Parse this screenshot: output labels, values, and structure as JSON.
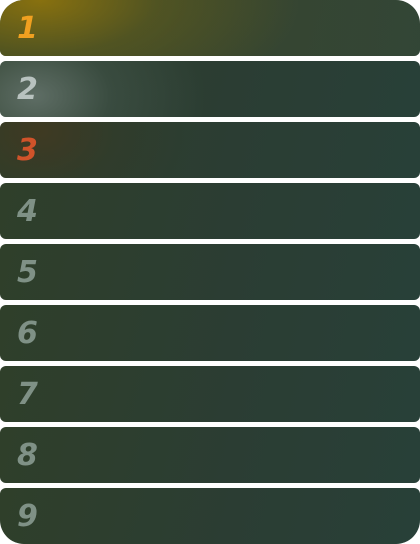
{
  "leaderboard": {
    "rows": [
      {
        "rank": "1",
        "color": "#f0a020",
        "glow": "gold"
      },
      {
        "rank": "2",
        "color": "#b8c2bf",
        "glow": "silver"
      },
      {
        "rank": "3",
        "color": "#d0532a",
        "glow": "bronze"
      },
      {
        "rank": "4",
        "color": "#7f9186",
        "glow": "none"
      },
      {
        "rank": "5",
        "color": "#7f9186",
        "glow": "none"
      },
      {
        "rank": "6",
        "color": "#7f9186",
        "glow": "none"
      },
      {
        "rank": "7",
        "color": "#7f9186",
        "glow": "none"
      },
      {
        "rank": "8",
        "color": "#7f9186",
        "glow": "none"
      },
      {
        "rank": "9",
        "color": "#7f9186",
        "glow": "none"
      }
    ]
  }
}
